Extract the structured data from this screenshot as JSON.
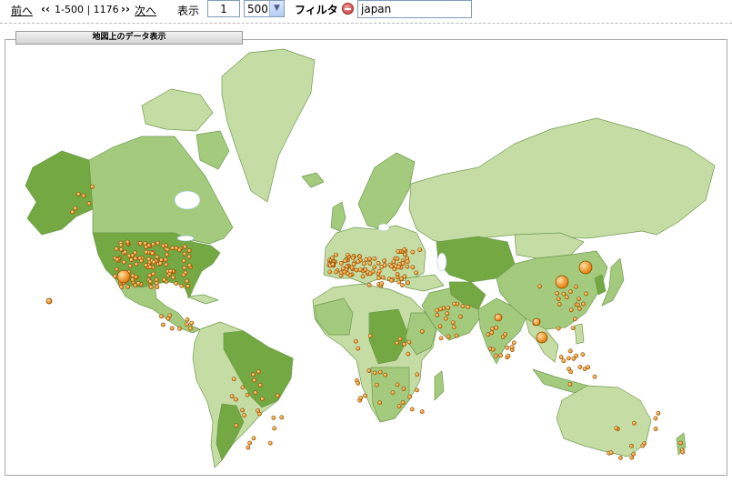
{
  "pager": {
    "prev_label": "前へ",
    "prev_arrows": "‹‹",
    "range_text": "1-500 | 1176",
    "next_arrows": "››",
    "next_label": "次へ"
  },
  "display": {
    "label": "表示",
    "start_value": "1",
    "rows_selected": "500"
  },
  "filter": {
    "label": "フィルタ",
    "icon": "minus-circle-icon",
    "value": "japan"
  },
  "map_panel": {
    "title": "地図上のデータ表示"
  },
  "colors": {
    "ocean": "#ffffff",
    "land_light": "#c5dda4",
    "land_mid": "#a4cb7d",
    "land_dark": "#74a842",
    "border": "#6f9a4e",
    "marker": "#f59a1c",
    "marker_edge": "#8a4b05"
  }
}
